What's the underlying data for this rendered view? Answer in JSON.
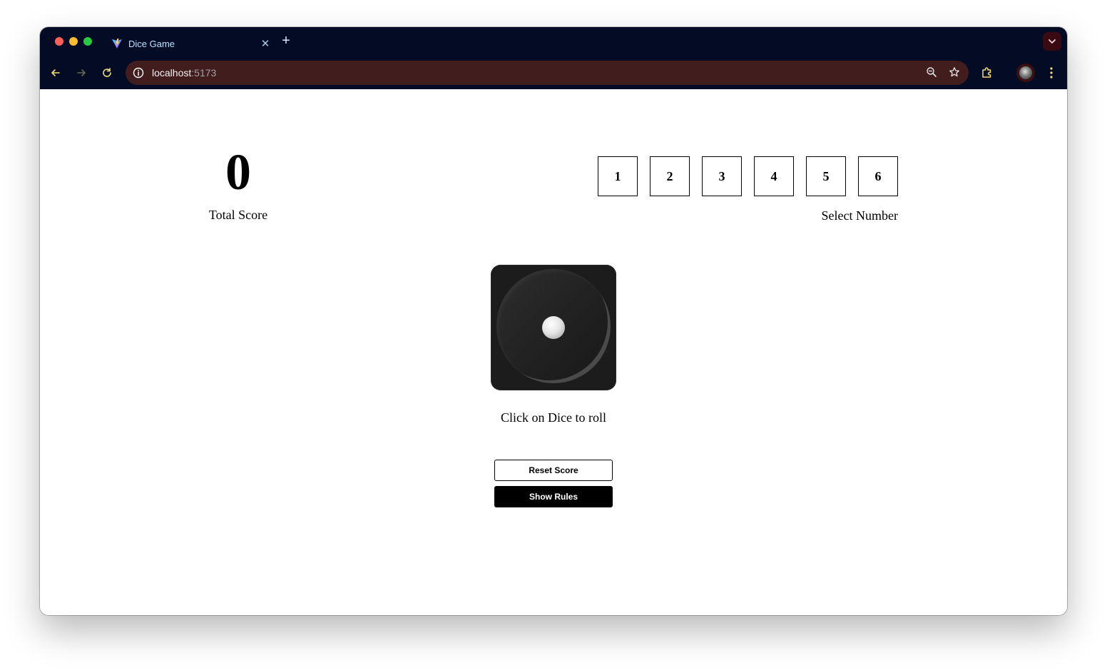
{
  "browser": {
    "tab_title": "Dice Game",
    "url_host": "localhost",
    "url_port": ":5173"
  },
  "game": {
    "total_score": "0",
    "total_score_label": "Total Score",
    "numbers": [
      "1",
      "2",
      "3",
      "4",
      "5",
      "6"
    ],
    "select_label": "Select Number",
    "dice_value": 1,
    "dice_hint": "Click on Dice to roll",
    "reset_button": "Reset Score",
    "rules_button": "Show Rules"
  },
  "colors": {
    "chrome_bg": "#030c24",
    "omnibox_bg": "#421d1e",
    "tab_text": "#b8e2ff",
    "dice_bg": "#1c1c1c",
    "primary_button_bg": "#000000"
  }
}
